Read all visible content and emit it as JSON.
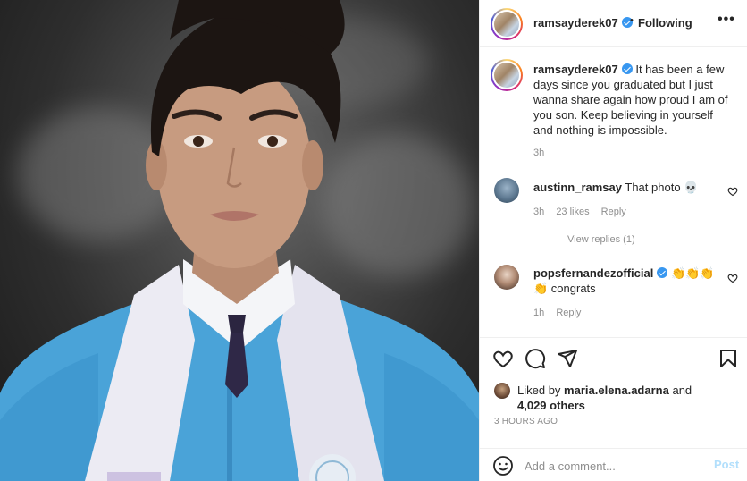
{
  "post": {
    "author": "ramsayderek07",
    "follow_status": "Following",
    "separator": "•",
    "more_icon": "more-horizontal-icon"
  },
  "caption": {
    "username": "ramsayderek07",
    "text": "It has been a few days since you graduated but I just wanna share again how proud I am of you son. Keep believing in yourself and nothing is impossible.",
    "time": "3h"
  },
  "comments": [
    {
      "username": "austinn_ramsay",
      "text": "That photo 💀",
      "time": "3h",
      "likes": "23 likes",
      "reply": "Reply",
      "view_replies": "View replies (1)"
    },
    {
      "username": "popsfernandezofficial",
      "emoji": "👏👏👏",
      "text": "👏 congrats",
      "time": "1h",
      "reply": "Reply"
    }
  ],
  "likes": {
    "prefix": "Liked by",
    "user": "maria.elena.adarna",
    "and": "and",
    "others": "4,029 others"
  },
  "timestamp": "3 HOURS AGO",
  "add_comment": {
    "placeholder": "Add a comment...",
    "post_label": "Post"
  },
  "colors": {
    "verified": "#3897f0",
    "gown": "#4aa3d8",
    "stole": "#ecebf3",
    "post_disabled": "#b2dffc"
  }
}
